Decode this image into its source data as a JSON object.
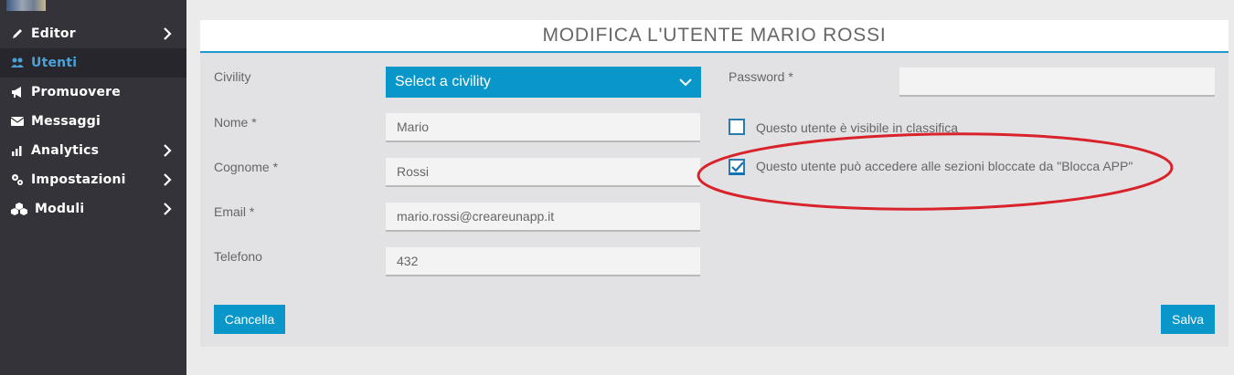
{
  "sidebar": {
    "items": [
      {
        "label": "Editor",
        "icon": "pencil-icon",
        "has_chevron": true
      },
      {
        "label": "Utenti",
        "icon": "users-icon",
        "has_chevron": false,
        "active": true
      },
      {
        "label": "Promuovere",
        "icon": "megaphone-icon",
        "has_chevron": false
      },
      {
        "label": "Messaggi",
        "icon": "envelope-icon",
        "has_chevron": false
      },
      {
        "label": "Analytics",
        "icon": "bar-chart-icon",
        "has_chevron": true
      },
      {
        "label": "Impostazioni",
        "icon": "gears-icon",
        "has_chevron": true
      },
      {
        "label": "Moduli",
        "icon": "cubes-icon",
        "has_chevron": true
      }
    ]
  },
  "form": {
    "title": "MODIFICA L'UTENTE MARIO ROSSI",
    "civility": {
      "label": "Civility",
      "value": "Select a civility"
    },
    "nome": {
      "label": "Nome *",
      "value": "Mario"
    },
    "cognome": {
      "label": "Cognome *",
      "value": "Rossi"
    },
    "email": {
      "label": "Email *",
      "value": "mario.rossi@creareunapp.it"
    },
    "telefono": {
      "label": "Telefono",
      "value": "432"
    },
    "password": {
      "label": "Password *",
      "value": ""
    },
    "visible_checkbox": {
      "label": "Questo utente è visibile in classifica",
      "checked": false
    },
    "blocca_checkbox": {
      "label": "Questo utente può accedere alle sezioni bloccate da \"Blocca APP\"",
      "checked": true
    },
    "cancel_label": "Cancella",
    "save_label": "Salva"
  },
  "colors": {
    "accent": "#0996c8",
    "sidebar_bg": "#34333a",
    "annotation": "#d9232a"
  }
}
